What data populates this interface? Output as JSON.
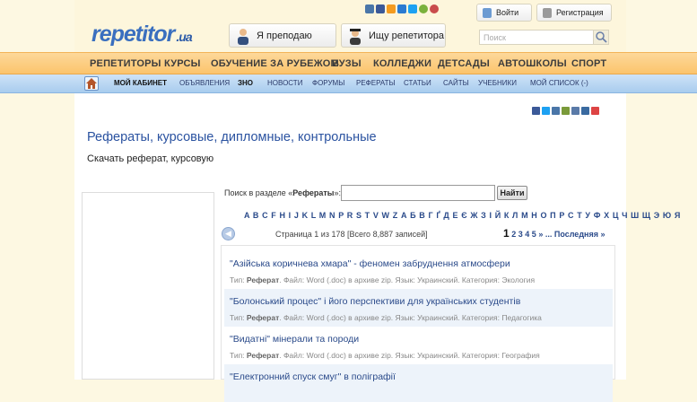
{
  "logo": {
    "text": "repetitor",
    "suffix": ".ua"
  },
  "header": {
    "teach_label": "Я преподаю",
    "find_label": "Ищу репетитора",
    "login_label": "Войти",
    "register_label": "Регистрация",
    "search_placeholder": "Поиск"
  },
  "nav_main": [
    "РЕПЕТИТОРЫ",
    "КУРСЫ",
    "ОБУЧЕНИЕ ЗА РУБЕЖОМ",
    "ВУЗЫ",
    "КОЛЛЕДЖИ",
    "ДЕТСАДЫ",
    "АВТОШКОЛЫ",
    "СПОРТ"
  ],
  "nav_sub": [
    "МОЙ КАБИНЕТ",
    "ОБЪЯВЛЕНИЯ",
    "ЗНО",
    "НОВОСТИ",
    "ФОРУМЫ",
    "РЕФЕРАТЫ",
    "СТАТЬИ",
    "САЙТЫ",
    "УЧЕБНИКИ",
    "МОЙ СПИСОК (-)"
  ],
  "page": {
    "title": "Рефераты, курсовые, дипломные, контрольные",
    "subtitle": "Скачать реферат, курсовую"
  },
  "section_search": {
    "label_prefix": "Поиск в разделе «",
    "label_section": "Рефераты",
    "label_suffix": "»:",
    "button": "Найти"
  },
  "alphabet": "A B C F H I J K L M N P R S T V W Z А Б В Г Ґ Д Е Є Ж З І Й К Л М Н О П Р С Т У Ф Х Ц Ч Ш Щ Э Ю Я",
  "pagination": {
    "info": "Страница 1 из 178 [Всего 8,887 записей]",
    "current": "1",
    "pages": [
      "2",
      "3",
      "4",
      "5"
    ],
    "more": "» ...",
    "last": "Последняя »"
  },
  "items": [
    {
      "title": "\"Азійська коричнева хмара\" - феномен забруднення атмосфери",
      "type_label": "Тип:",
      "type": "Реферат",
      "meta": ". Файл: Word (.doc) в архиве zip. Язык: Украинский. Категория: Экология"
    },
    {
      "title": "\"Болонський процес\" і його перспективи для українських студентів",
      "type_label": "Тип:",
      "type": "Реферат",
      "meta": ". Файл: Word (.doc) в архиве zip. Язык: Украинский. Категория: Педагогика"
    },
    {
      "title": "\"Видатні\" мінерали та породи",
      "type_label": "Тип:",
      "type": "Реферат",
      "meta": ". Файл: Word (.doc) в архиве zip. Язык: Украинский. Категория: География"
    },
    {
      "title": "\"Електронний спуск смуг\" в поліграфії"
    }
  ]
}
